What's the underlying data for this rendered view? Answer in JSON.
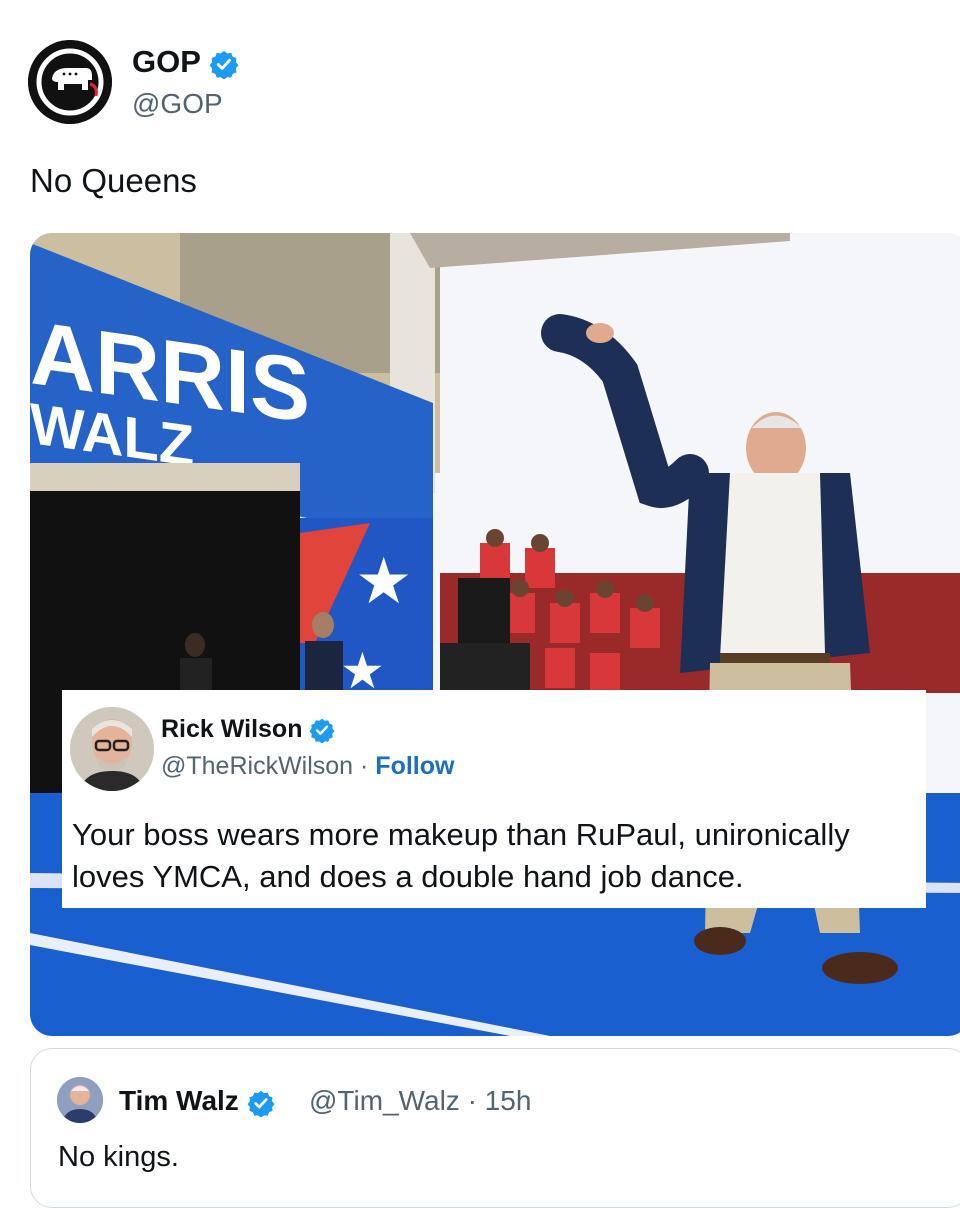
{
  "tweet": {
    "author_name": "GOP",
    "author_handle": "@GOP",
    "verified": true,
    "text": "No Queens"
  },
  "media": {
    "sign_line1": "ARRIS",
    "sign_line2": "WALZ"
  },
  "overlay_tweet": {
    "author_name": "Rick Wilson",
    "author_handle": "@TheRickWilson",
    "separator": " · ",
    "follow_label": "Follow",
    "text": "Your boss wears more makeup than RuPaul, unironically loves YMCA, and does a double hand job dance."
  },
  "quoted_tweet": {
    "author_name": "Tim Walz",
    "author_handle": "@Tim_Walz · 15h",
    "text": "No kings."
  },
  "colors": {
    "verified_blue": "#1d9bf0",
    "stage_blue": "#1a5fd0",
    "sign_blue": "#2563c9"
  },
  "icons": [
    "gop-elephant-logo",
    "verified-badge-icon"
  ]
}
